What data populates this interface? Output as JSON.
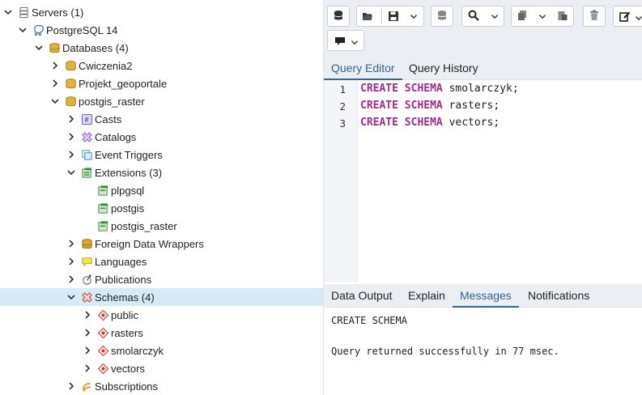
{
  "tree": {
    "servers_label": "Servers (1)",
    "server_label": "PostgreSQL 14",
    "databases_label": "Databases (4)",
    "db_cwiczenia2": "Cwiczenia2",
    "db_projekt": "Projekt_geoportale",
    "db_postgis_raster": "postgis_raster",
    "casts": "Casts",
    "catalogs": "Catalogs",
    "event_triggers": "Event Triggers",
    "extensions": "Extensions (3)",
    "ext_plpgsql": "plpgsql",
    "ext_postgis": "postgis",
    "ext_postgis_raster": "postgis_raster",
    "fdw": "Foreign Data Wrappers",
    "languages": "Languages",
    "publications": "Publications",
    "schemas": "Schemas (4)",
    "schema_public": "public",
    "schema_rasters": "rasters",
    "schema_smolarczyk": "smolarczyk",
    "schema_vectors": "vectors",
    "subscriptions": "Subscriptions"
  },
  "editor_tabs": [
    "Query Editor",
    "Query History"
  ],
  "editor": {
    "line_numbers": [
      "1",
      "2",
      "3"
    ],
    "lines": [
      {
        "kw": "CREATE SCHEMA",
        "rest": " smolarczyk;"
      },
      {
        "kw": "CREATE SCHEMA",
        "rest": " rasters;"
      },
      {
        "kw": "CREATE SCHEMA",
        "rest": " vectors;"
      }
    ]
  },
  "output_tabs": [
    "Data Output",
    "Explain",
    "Messages",
    "Notifications"
  ],
  "messages": [
    "CREATE SCHEMA",
    "Query returned successfully in 77 msec."
  ],
  "colors": {
    "accent": "#326690",
    "keyword": "#a02b8e",
    "selected": "#d6eaf8",
    "toolbar_bg": "#ebeef3"
  },
  "icons": [
    "database-icon",
    "folder-open-icon",
    "save-icon",
    "chevron-down-icon",
    "search-icon",
    "copy-icon",
    "paste-icon",
    "trash-icon",
    "edit-icon",
    "execute-icon"
  ]
}
